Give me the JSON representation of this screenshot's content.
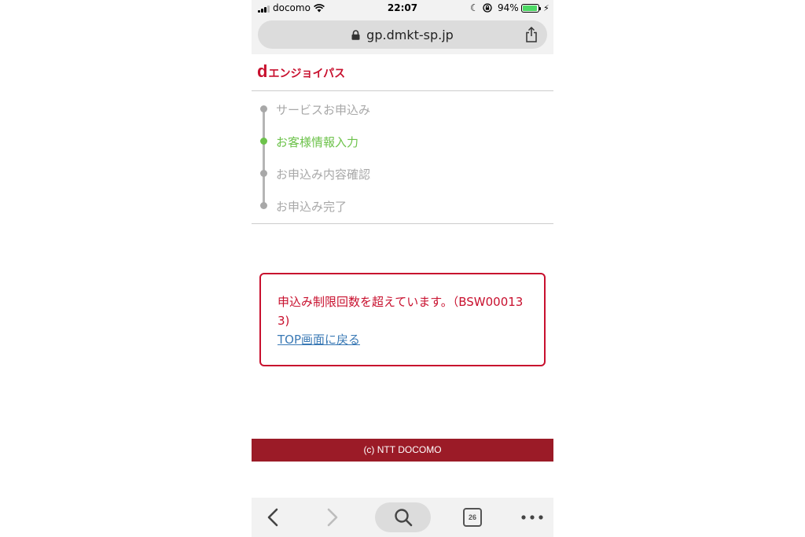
{
  "status_bar": {
    "carrier": "docomo",
    "time": "22:07",
    "battery_percent": "94%",
    "battery_level": 0.94,
    "icons": [
      "signal-icon",
      "wifi-icon",
      "moon-icon",
      "rotation-lock-icon",
      "battery-icon",
      "bolt-icon"
    ]
  },
  "browser": {
    "url": "gp.dmkt-sp.jp",
    "tab_count": "26",
    "icons": [
      "lock-icon",
      "share-icon",
      "back-icon",
      "forward-icon",
      "search-icon",
      "tabs-icon",
      "more-icon"
    ]
  },
  "site": {
    "logo_d": "d",
    "logo_text": "エンジョイパス",
    "brand_color": "#c8102e",
    "active_color": "#6cc24a"
  },
  "steps": [
    {
      "label": "サービスお申込み",
      "active": false
    },
    {
      "label": "お客様情報入力",
      "active": true
    },
    {
      "label": "お申込み内容確認",
      "active": false
    },
    {
      "label": "お申込み完了",
      "active": false
    }
  ],
  "error": {
    "message": "申込み制限回数を超えています。（BSW000133)",
    "link": "TOP画面に戻る"
  },
  "footer": {
    "copyright": "(c) NTT DOCOMO",
    "color": "#9b1b27"
  }
}
